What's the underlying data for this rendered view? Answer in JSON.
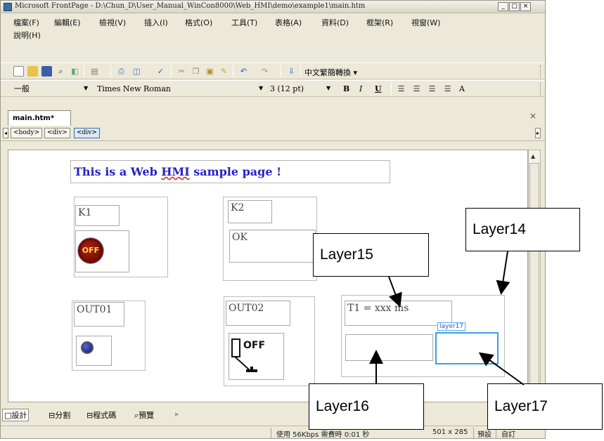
{
  "window": {
    "title": "Microsoft FrontPage - D:\\Chun_D\\User_Manual_WinCon8000\\Web_HMI\\demo\\example1\\main.htm",
    "controls": [
      "_",
      "□",
      "×"
    ]
  },
  "menu": {
    "row1": [
      "檔案(F)",
      "編輯(E)",
      "檢視(V)",
      "插入(I)",
      "格式(O)",
      "工具(T)",
      "表格(A)",
      "資料(D)",
      "框架(R)",
      "視窗(W)"
    ],
    "row2": [
      "說明(H)"
    ]
  },
  "toolbar": {
    "convert_label": "中文繁簡轉換 ▾"
  },
  "format_bar": {
    "style": "一般",
    "font": "Times New Roman",
    "size": "3 (12 pt)",
    "bold": "B",
    "italic": "I",
    "underline": "U",
    "font_color": "A"
  },
  "document": {
    "tab_label": "main.htm*",
    "close": "×",
    "tags": [
      "<body>",
      "<div>",
      "<div>"
    ]
  },
  "page": {
    "heading_prefix": "This is a Web ",
    "heading_hmi": "HMI",
    "heading_suffix": " sample page !",
    "k1": "K1",
    "off_button": "OFF",
    "k2": "K2",
    "ok": "OK",
    "out01": "OUT01",
    "out02": "OUT02",
    "switch_label": "OFF",
    "t1": "T1 = xxx ms",
    "layer17_tag": "layer17"
  },
  "views": {
    "design": "設計",
    "split": "分割",
    "code": "程式碼",
    "preview": "預覽"
  },
  "status": {
    "message": "使用 56Kbps 需費時 0:01 秒",
    "dims": "501 x 285",
    "preset": "預設",
    "custom": "自訂"
  },
  "annotations": {
    "layer14": "Layer14",
    "layer15": "Layer15",
    "layer16": "Layer16",
    "layer17": "Layer17"
  },
  "colors": {
    "heading": "#2222cc",
    "selection": "#3aa0e8",
    "off_button": "#8b1108"
  }
}
